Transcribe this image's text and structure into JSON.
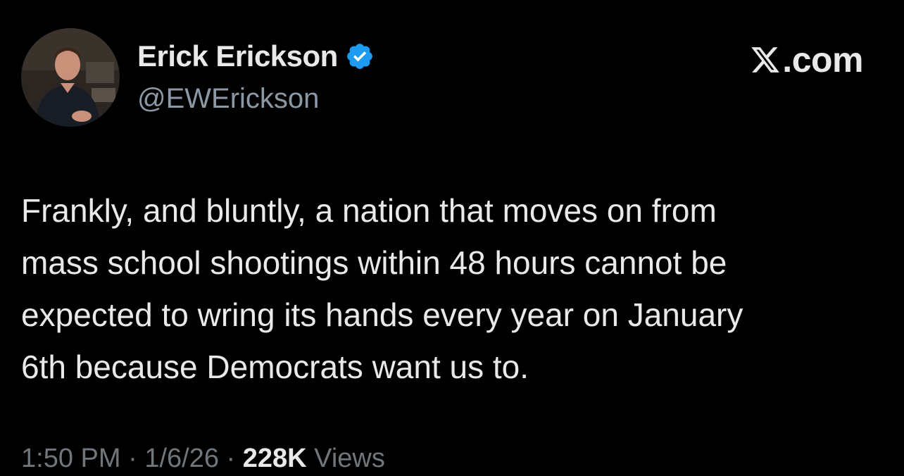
{
  "author": {
    "display_name": "Erick Erickson",
    "handle": "@EWErickson",
    "verified": true,
    "verified_color": "#1d9bf0",
    "avatar_icon": "profile-photo"
  },
  "site": {
    "logo_icon": "x-logo-icon",
    "suffix": ".com"
  },
  "tweet": {
    "lines": [
      "Frankly, and bluntly, a nation that moves on from",
      "mass school shootings within 48 hours cannot be",
      "expected to wring its hands every year on January",
      "6th because Democrats want us to."
    ]
  },
  "meta": {
    "time": "1:50 PM",
    "separator": "·",
    "date": "1/6/26",
    "views_count": "228K",
    "views_label": "Views"
  },
  "colors": {
    "background": "#000000",
    "primary_text": "#e7e9ea",
    "secondary_text": "#71767b",
    "accent": "#1d9bf0"
  }
}
